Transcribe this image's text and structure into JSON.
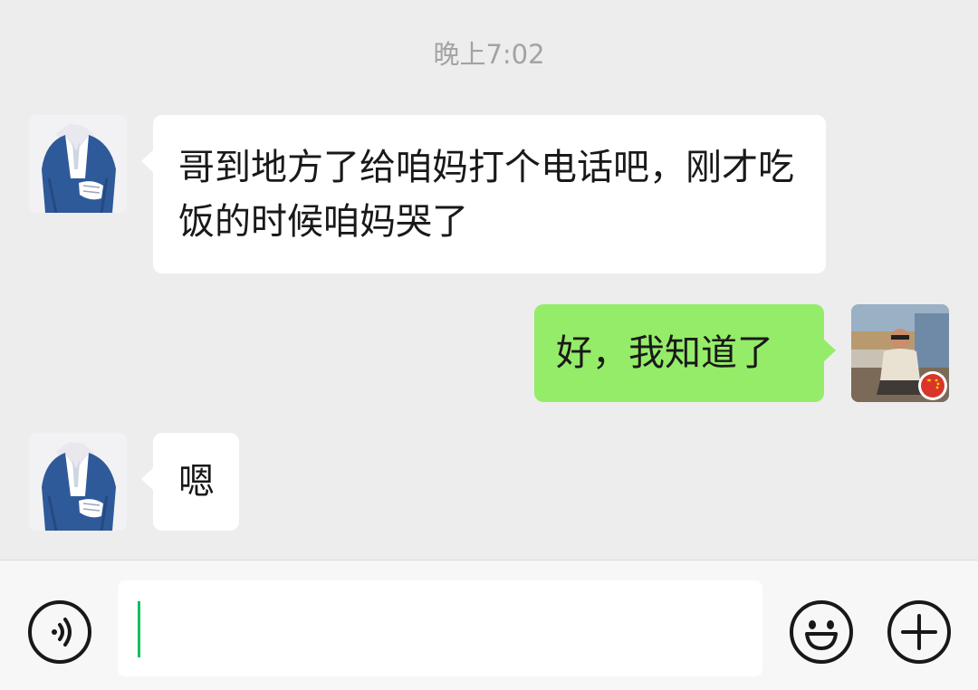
{
  "chat": {
    "timestamp": "晚上7:02",
    "messages": [
      {
        "side": "left",
        "avatar": "contact-avatar",
        "text": "哥到地方了给咱妈打个电话吧，刚才吃饭的时候咱妈哭了"
      },
      {
        "side": "right",
        "avatar": "self-avatar",
        "text": "好，我知道了"
      },
      {
        "side": "left",
        "avatar": "contact-avatar",
        "text": "嗯"
      }
    ]
  },
  "input_bar": {
    "voice_icon": "voice-icon",
    "emoji_icon": "emoji-icon",
    "plus_icon": "plus-icon",
    "input_value": ""
  },
  "colors": {
    "background": "#ededed",
    "bubble_self": "#95ec69",
    "bubble_other": "#ffffff",
    "caret": "#07c160",
    "timestamp": "#a3a3a3"
  }
}
